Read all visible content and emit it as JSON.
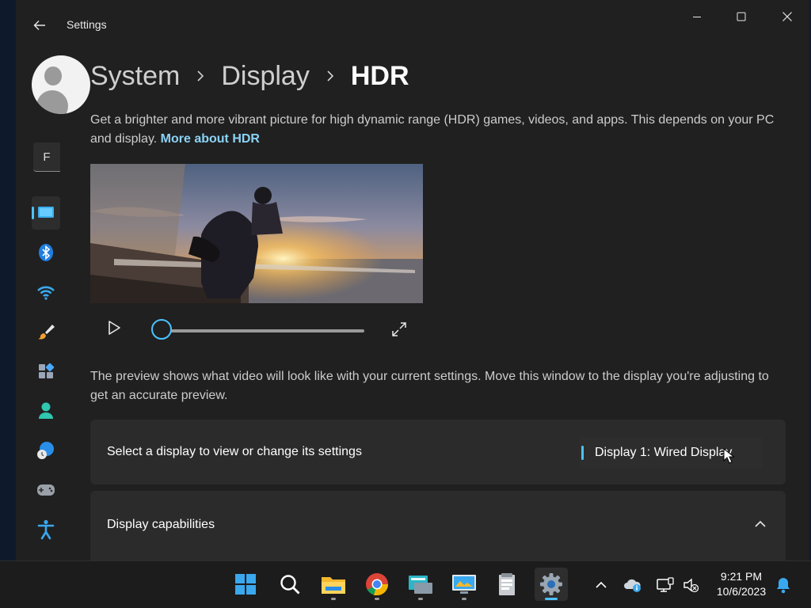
{
  "window": {
    "title": "Settings",
    "controls": {
      "minimize": "minimize-icon",
      "maximize": "maximize-icon",
      "close": "close-icon"
    }
  },
  "sidebar": {
    "search_letter": "F",
    "items": [
      {
        "name": "system",
        "icon": "monitor-icon",
        "selected": true
      },
      {
        "name": "bluetooth",
        "icon": "bluetooth-icon"
      },
      {
        "name": "network",
        "icon": "wifi-icon"
      },
      {
        "name": "personalization",
        "icon": "brush-icon"
      },
      {
        "name": "apps",
        "icon": "apps-icon"
      },
      {
        "name": "accounts",
        "icon": "person-icon"
      },
      {
        "name": "time-language",
        "icon": "globe-clock-icon"
      },
      {
        "name": "gaming",
        "icon": "gamepad-icon"
      },
      {
        "name": "accessibility",
        "icon": "accessibility-icon"
      }
    ]
  },
  "breadcrumb": [
    "System",
    "Display",
    "HDR"
  ],
  "description": {
    "text": "Get a brighter and more vibrant picture for high dynamic range (HDR) games, videos, and apps. This depends on your PC and display. ",
    "link": "More about HDR"
  },
  "player": {
    "progress": 0
  },
  "preview_note": "The preview shows what video will look like with your current settings. Move this window to the display you're adjusting to get an accurate preview.",
  "display_select": {
    "label": "Select a display to view or change its settings",
    "value": "Display 1: Wired Display"
  },
  "capabilities": {
    "label": "Display capabilities",
    "expanded": true
  },
  "taskbar": {
    "apps": [
      "start-icon",
      "search-icon",
      "file-explorer-icon",
      "chrome-icon",
      "app-icon",
      "app-icon",
      "app-icon",
      "settings-icon"
    ],
    "active_app": "settings-icon",
    "clock": {
      "time": "9:21 PM",
      "date": "10/6/2023"
    }
  },
  "colors": {
    "accent": "#4cc2ff",
    "link": "#8bd3f7",
    "background": "#202020",
    "card": "#2b2b2b"
  }
}
